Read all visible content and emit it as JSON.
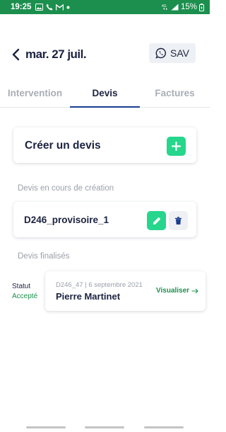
{
  "status_bar": {
    "time": "19:25",
    "battery": "15%",
    "network": "4G"
  },
  "header": {
    "date": "mar. 27 juil.",
    "sav_label": "SAV"
  },
  "tabs": [
    {
      "label": "Intervention",
      "active": false
    },
    {
      "label": "Devis",
      "active": true
    },
    {
      "label": "Factures",
      "active": false
    }
  ],
  "create_card": {
    "label": "Créer un devis"
  },
  "drafts": {
    "title": "Devis en cours de création",
    "items": [
      {
        "name": "D246_provisoire_1"
      }
    ]
  },
  "finalized": {
    "title": "Devis finalisés",
    "statut_label": "Statut",
    "statut_value": "Accepté",
    "items": [
      {
        "ref": "D246_47",
        "separator": "|",
        "date": "6 septembre 2021",
        "client": "Pierre Martinet",
        "action": "Visualiser"
      }
    ]
  },
  "colors": {
    "status_bar": "#1c8f4e",
    "accent_green": "#26d68c",
    "navy": "#1c2340",
    "tab_indicator": "#1a3d8f",
    "accepted": "#1c8f4e"
  }
}
